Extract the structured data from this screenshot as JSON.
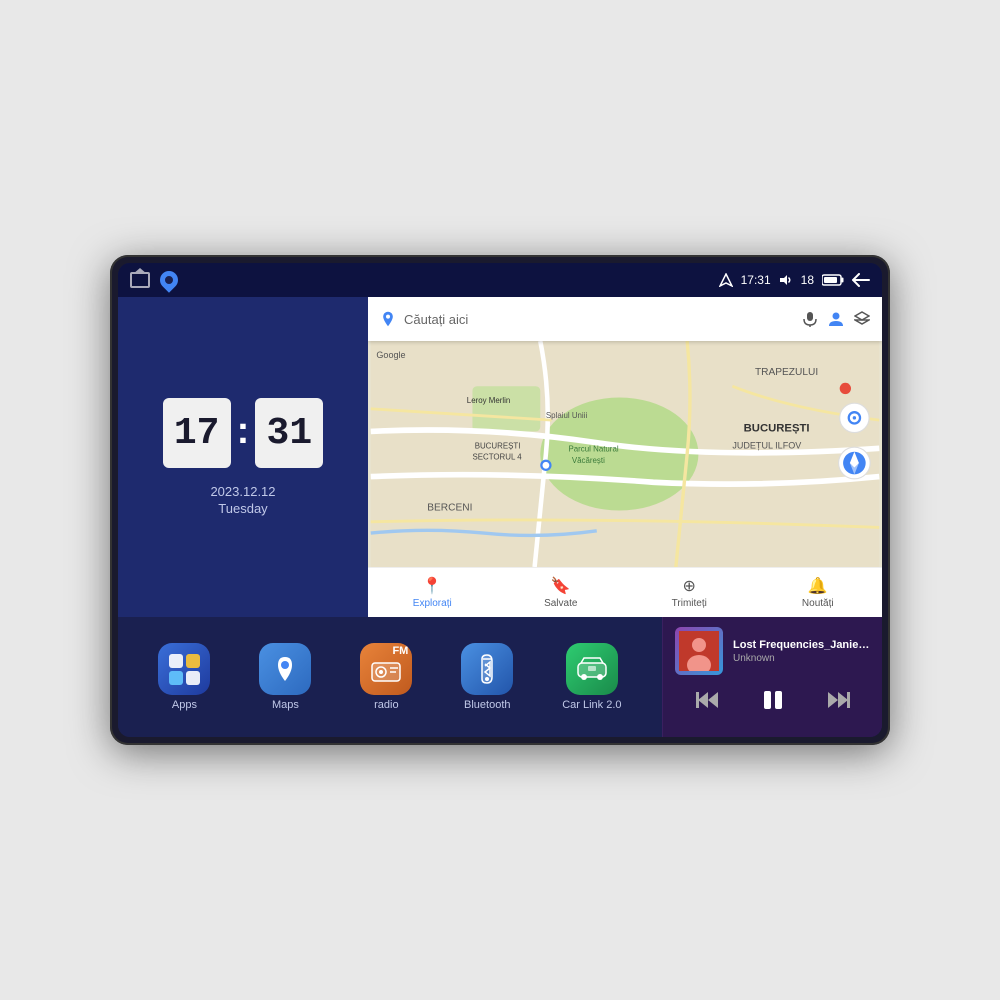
{
  "device": {
    "status_bar": {
      "left_icons": [
        "home",
        "maps-pin"
      ],
      "time": "17:31",
      "volume_level": "18",
      "battery_icon": "battery",
      "back_icon": "back"
    },
    "clock": {
      "hours": "17",
      "minutes": "31",
      "date": "2023.12.12",
      "day": "Tuesday"
    },
    "map": {
      "search_placeholder": "Căutați aici",
      "labels": {
        "trapezului": "TRAPEZULUI",
        "bucuresti": "BUCUREȘTI",
        "judet": "JUDEȚUL ILFOV",
        "berceni": "BERCENI",
        "leroy": "Leroy Merlin",
        "parc": "Parcul Natural Văcărești",
        "sector": "BUCUREȘTI\nSECTORUL 4",
        "splai": "Splaiul Uniii"
      },
      "bottom_tabs": [
        {
          "label": "Explorați",
          "icon": "📍",
          "active": true
        },
        {
          "label": "Salvate",
          "icon": "🔖",
          "active": false
        },
        {
          "label": "Trimiteți",
          "icon": "⊕",
          "active": false
        },
        {
          "label": "Noutăți",
          "icon": "🔔",
          "active": false
        }
      ]
    },
    "apps": [
      {
        "id": "apps",
        "label": "Apps",
        "color_class": "apps-icon"
      },
      {
        "id": "maps",
        "label": "Maps",
        "color_class": "maps-icon"
      },
      {
        "id": "radio",
        "label": "radio",
        "color_class": "radio-icon"
      },
      {
        "id": "bluetooth",
        "label": "Bluetooth",
        "color_class": "bluetooth-icon"
      },
      {
        "id": "carlink",
        "label": "Car Link 2.0",
        "color_class": "carlink-icon"
      }
    ],
    "music": {
      "title": "Lost Frequencies_Janieck Devy-...",
      "artist": "Unknown",
      "controls": {
        "prev": "⏮",
        "play": "⏸",
        "next": "⏭"
      }
    }
  }
}
